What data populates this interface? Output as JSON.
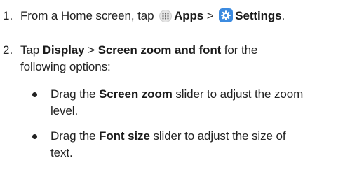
{
  "steps": [
    {
      "number": "1.",
      "text_a": "From a Home screen, tap",
      "bold_apps": "Apps",
      "sep": ">",
      "bold_settings": "Settings",
      "end": "."
    },
    {
      "number": "2.",
      "text_a": "Tap",
      "bold_display": "Display",
      "sep": ">",
      "bold_zoom_font": "Screen zoom and font",
      "text_b": "for the",
      "line2": "following options:"
    }
  ],
  "bullets": [
    {
      "pre": "Drag the",
      "bold": "Screen zoom",
      "post": "slider to adjust the zoom",
      "line2": "level."
    },
    {
      "pre": "Drag the",
      "bold": "Font size",
      "post": "slider to adjust the size of",
      "line2": "text."
    }
  ],
  "icons": {
    "apps": "apps-grid-icon",
    "settings": "settings-gear-icon",
    "apps_color": "#e6e6e6",
    "settings_color": "#3c8be0"
  }
}
